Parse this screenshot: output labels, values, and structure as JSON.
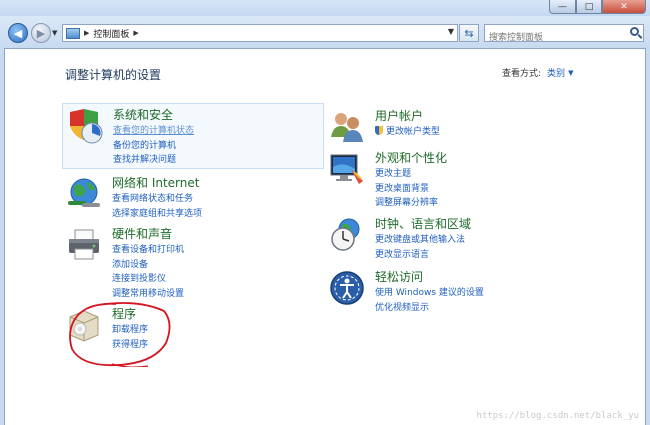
{
  "window": {
    "minimize": "—",
    "maximize": "□",
    "close": "✕"
  },
  "nav": {
    "back": "◀",
    "forward": "▶"
  },
  "address": {
    "path": "控制面板"
  },
  "search": {
    "placeholder": "搜索控制面板"
  },
  "page": {
    "title": "调整计算机的设置",
    "view_by_label": "查看方式:",
    "view_by_value": "类别"
  },
  "categories": {
    "system": {
      "title": "系统和安全",
      "links": [
        "查看您的计算机状态",
        "备份您的计算机",
        "查找并解决问题"
      ]
    },
    "network": {
      "title": "网络和 Internet",
      "links": [
        "查看网络状态和任务",
        "选择家庭组和共享选项"
      ]
    },
    "hardware": {
      "title": "硬件和声音",
      "links": [
        "查看设备和打印机",
        "添加设备",
        "连接到投影仪",
        "调整常用移动设置"
      ]
    },
    "programs": {
      "title": "程序",
      "links": [
        "卸载程序",
        "获得程序"
      ]
    },
    "users": {
      "title": "用户帐户",
      "links": [
        "更改帐户类型"
      ]
    },
    "appearance": {
      "title": "外观和个性化",
      "links": [
        "更改主题",
        "更改桌面背景",
        "调整屏幕分辨率"
      ]
    },
    "clock": {
      "title": "时钟、语言和区域",
      "links": [
        "更改键盘或其他输入法",
        "更改显示语言"
      ]
    },
    "ease": {
      "title": "轻松访问",
      "links": [
        "使用 Windows 建议的设置",
        "优化视频显示"
      ]
    }
  },
  "watermark": "https://blog.csdn.net/black_yu",
  "colors": {
    "link": "#1f5fbf",
    "category_title": "#1e6a2a",
    "annotation": "#d4141e"
  }
}
